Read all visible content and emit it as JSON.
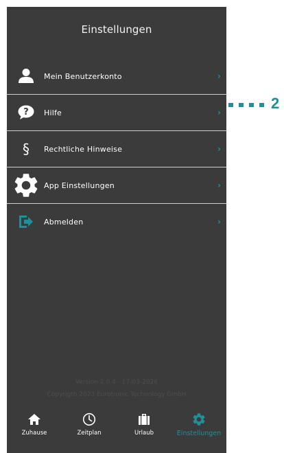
{
  "colors": {
    "accent": "#1f8f9a",
    "background": "#3b3b3b",
    "divider": "#cfcfcf",
    "footer_text": "#4d4d4d"
  },
  "header": {
    "title": "Einstellungen"
  },
  "menu": {
    "items": [
      {
        "label": "Mein Benutzerkonto",
        "icon": "user-icon"
      },
      {
        "label": "Hilfe",
        "icon": "help-bubble-icon"
      },
      {
        "label": "Rechtliche Hinweise",
        "icon": "section-sign-icon"
      },
      {
        "label": "App Einstellungen",
        "icon": "gear-icon"
      },
      {
        "label": "Abmelden",
        "icon": "logout-icon"
      }
    ],
    "chevron": "›"
  },
  "footer": {
    "version": "Version 2.0.4 - 17-03-2026",
    "copyright": "Copyrigth 2023 Eurotronic Technology GmbH"
  },
  "tabbar": {
    "tabs": [
      {
        "label": "Zuhause",
        "icon": "home-icon",
        "active": false
      },
      {
        "label": "Zeitplan",
        "icon": "clock-icon",
        "active": false
      },
      {
        "label": "Urlaub",
        "icon": "suitcase-icon",
        "active": false
      },
      {
        "label": "Einstellungen",
        "icon": "gear-icon",
        "active": true
      }
    ]
  },
  "callout": {
    "number": "2"
  }
}
